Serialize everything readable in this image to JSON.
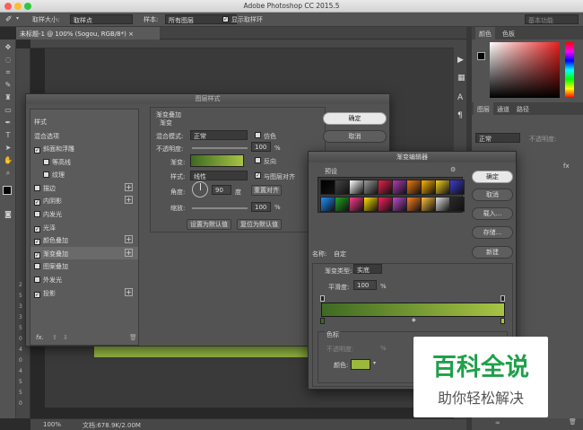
{
  "app": {
    "title": "Adobe Photoshop CC 2015.5"
  },
  "options_bar": {
    "sample_size_label": "取样大小:",
    "sample_size_value": "取样点",
    "sample_label": "样本:",
    "sample_value": "所有图层",
    "show_ring_label": "显示取样环",
    "workspace": "基本功能"
  },
  "document": {
    "tab_title": "未标题-1 @ 100% (Sogou, RGB/8*) ×",
    "zoom": "100%",
    "doc_size": "文档:678.9K/2.00M"
  },
  "ruler_left_marks": [
    "2",
    "5",
    "3",
    "3",
    "5",
    "0",
    "4",
    "0",
    "4",
    "5",
    "5",
    "0"
  ],
  "right_panels": {
    "color_tabs": [
      "颜色",
      "色板"
    ],
    "layer_tabs": [
      "图层",
      "通道",
      "路径"
    ],
    "blend_mode": "正常",
    "opacity_label": "不透明度:",
    "layer_effects": [
      "fx",
      "ogou",
      "面和浮雕",
      "阴影",
      "光",
      "色叠加",
      "变叠加",
      "影"
    ]
  },
  "layer_style": {
    "title": "图层样式",
    "styles_header": "样式",
    "blend_options": "混合选项",
    "items": [
      {
        "label": "斜面和浮雕",
        "checked": true,
        "plus": false,
        "indent": false
      },
      {
        "label": "等高线",
        "checked": false,
        "plus": false,
        "indent": true
      },
      {
        "label": "纹理",
        "checked": false,
        "plus": false,
        "indent": true
      },
      {
        "label": "描边",
        "checked": false,
        "plus": true,
        "indent": false
      },
      {
        "label": "内阴影",
        "checked": true,
        "plus": true,
        "indent": false
      },
      {
        "label": "内发光",
        "checked": false,
        "plus": false,
        "indent": false
      },
      {
        "label": "光泽",
        "checked": true,
        "plus": false,
        "indent": false
      },
      {
        "label": "颜色叠加",
        "checked": true,
        "plus": true,
        "indent": false
      },
      {
        "label": "渐变叠加",
        "checked": true,
        "plus": true,
        "indent": false
      },
      {
        "label": "图案叠加",
        "checked": false,
        "plus": false,
        "indent": false
      },
      {
        "label": "外发光",
        "checked": false,
        "plus": false,
        "indent": false
      },
      {
        "label": "投影",
        "checked": true,
        "plus": true,
        "indent": false
      }
    ],
    "section_title": "渐变叠加",
    "section_sub": "渐变",
    "blend_mode_label": "混合模式:",
    "blend_mode_value": "正常",
    "dither_label": "仿色",
    "opacity_label": "不透明度:",
    "opacity_value": "100",
    "opacity_unit": "%",
    "gradient_label": "渐变:",
    "reverse_label": "反向",
    "style_label": "样式:",
    "style_value": "线性",
    "align_label": "与图层对齐",
    "angle_label": "角度:",
    "angle_value": "90",
    "angle_unit": "度",
    "reset_align": "重置对齐",
    "scale_label": "缩放:",
    "scale_value": "100",
    "scale_unit": "%",
    "set_default": "设置为默认值",
    "reset_default": "复位为默认值",
    "ok": "确定",
    "cancel": "取消",
    "fx_label": "fx."
  },
  "gradient_editor": {
    "title": "渐变编辑器",
    "presets_label": "预设",
    "ok": "确定",
    "cancel": "取消",
    "load": "载入...",
    "save": "存储...",
    "name_label": "名称:",
    "name_value": "自定",
    "new": "新建",
    "type_label": "渐变类型:",
    "type_value": "实底",
    "smooth_label": "平滑度:",
    "smooth_value": "100",
    "smooth_unit": "%",
    "stops_label": "色标",
    "stop_opacity_label": "不透明度:",
    "stop_opacity_unit": "%",
    "stop_color_label": "颜色:",
    "stop_color": "#9bb83c",
    "preset_swatches": [
      "#000000",
      "#444444",
      "#ffffff",
      "#999999",
      "#e8204a",
      "#b23ab6",
      "#f07a10",
      "#ffb400",
      "#f5d020",
      "#3a3ad0",
      "#1e90ff",
      "#22a322",
      "#ff3a8c",
      "#ffe000",
      "#ff2060",
      "#c04ad0",
      "#ff8020",
      "#ffc040",
      "#e0e0e0",
      "#2a2a2a"
    ]
  },
  "watermark": {
    "title": "百科全说",
    "subtitle": "助你轻松解决"
  }
}
